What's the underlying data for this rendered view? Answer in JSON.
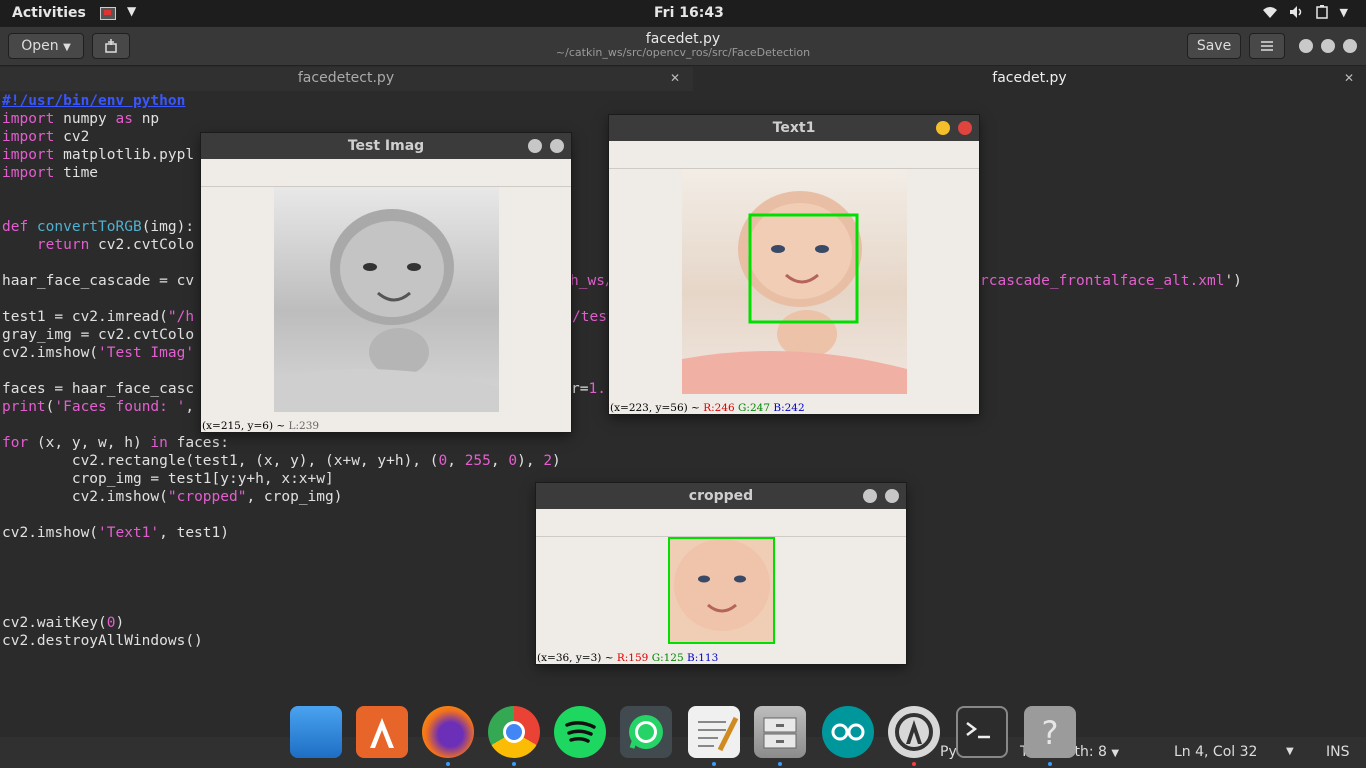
{
  "topbar": {
    "activities": "Activities",
    "clock": "Fri 16:43",
    "tray_icons": [
      "wifi-icon",
      "volume-icon",
      "battery-icon",
      "chevron-down-icon"
    ]
  },
  "headerbar": {
    "open_label": "Open",
    "save_label": "Save",
    "title": "facedet.py",
    "subtitle": "~/catkin_ws/src/opencv_ros/src/FaceDetection"
  },
  "tabs": [
    {
      "label": "facedetect.py",
      "active": false
    },
    {
      "label": "facedet.py",
      "active": true
    }
  ],
  "code": {
    "l1": "#!/usr/bin/env python",
    "l2a": "import",
    "l2b": " numpy ",
    "l2c": "as",
    "l2d": " np",
    "l3a": "import",
    "l3b": " cv2",
    "l4a": "import",
    "l4b": " matplotlib.pypl",
    "l5a": "import",
    "l5b": " time",
    "l8a": "def",
    "l8b": " convertToRGB",
    "l8c": "(img):",
    "l9a": "    return",
    "l9b": " cv2.cvtColo",
    "l11a": "haar_face_cascade = cv",
    "l11b": "h_ws/",
    "l11c": "rcascade_frontalface_alt.xml",
    "l11d": "')",
    "l13a": "test1 = cv2.imread(",
    "l13b": "\"/h",
    "l13c": "/test",
    "l14": "gray_img = cv2.cvtColo",
    "l15a": "cv2.imshow(",
    "l15b": "'Test Imag'",
    "l17a": "faces = haar_face_casc",
    "l17b": "r=",
    "l17c": "1.",
    "l18a": "print",
    "l18b": "(",
    "l18c": "'Faces found: '",
    "l18d": ",",
    "l20a": "for",
    "l20b": " (x, y, w, h) ",
    "l20c": "in",
    "l20d": " faces:",
    "l21a": "        cv2.rectangle(test1, (x, y), (x+w, y+h), (",
    "l21b": "0",
    "l21c": ", ",
    "l21d": "255",
    "l21e": ", ",
    "l21f": "0",
    "l21g": "), ",
    "l21h": "2",
    "l21i": ")",
    "l22": "        crop_img = test1[y:y+h, x:x+w]",
    "l23a": "        cv2.imshow(",
    "l23b": "\"cropped\"",
    "l23c": ", crop_img)",
    "l25a": "cv2.imshow(",
    "l25b": "'Text1'",
    "l25c": ", test1)",
    "l30a": "cv2.waitKey(",
    "l30b": "0",
    "l30c": ")",
    "l31": "cv2.destroyAllWindows()"
  },
  "windows": {
    "test_imag": {
      "title": "Test Imag",
      "status_coords": "(x=215, y=6) ~ ",
      "status_l": "L:239"
    },
    "text1": {
      "title": "Text1",
      "status_coords": "(x=223, y=56) ~ ",
      "status_r": "R:246",
      "status_g": "G:247",
      "status_b": "B:242"
    },
    "cropped": {
      "title": "cropped",
      "status_coords": "(x=36, y=3) ~ ",
      "status_r": "R:159",
      "status_g": "G:125",
      "status_b": "B:113"
    }
  },
  "statusbar": {
    "language": "Python",
    "tab_width": "Tab Width: 8",
    "position": "Ln 4, Col 32",
    "mode": "INS"
  },
  "dock": [
    "files-icon",
    "software-center-icon",
    "firefox-icon",
    "chrome-icon",
    "spotify-icon",
    "whatsapp-icon",
    "text-editor-icon",
    "file-cabinet-icon",
    "arduino-icon",
    "software-updater-icon",
    "terminal-icon",
    "help-icon"
  ],
  "colors": {
    "accent_green": "#00e000",
    "close_red": "#e0443e",
    "minimize_yellow": "#f4bf2a"
  }
}
